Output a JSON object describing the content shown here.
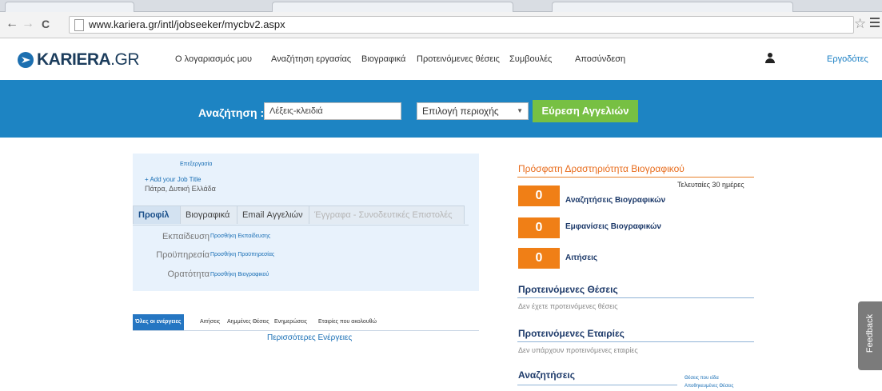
{
  "browser": {
    "url": "www.kariera.gr/intl/jobseeker/mycbv2.aspx",
    "back_icon": "←",
    "forward_icon": "→",
    "reload_icon": "C",
    "star_icon": "☆"
  },
  "header": {
    "logo_bold": "KARIERA",
    "logo_light": ".GR",
    "nav": [
      "Ο λογαριασμός μου",
      "Αναζήτηση εργασίας",
      "Βιογραφικά",
      "Προτεινόμενες θέσεις",
      "Συμβουλές",
      "Αποσύνδεση"
    ],
    "employers": "Εργοδότες"
  },
  "search": {
    "label": "Αναζήτηση :",
    "keywords_value": "Λέξεις-κλειδιά",
    "region_value": "Επιλογή περιοχής",
    "button": "Εύρεση Αγγελιών"
  },
  "profile": {
    "edit": "Επεξεργασία",
    "add_title": "+ Add your Job Title",
    "location": "Πάτρα, Δυτική Ελλάδα",
    "tabs": [
      "Προφίλ",
      "Βιογραφικά",
      "Email Αγγελιών",
      "Έγγραφα - Συνοδευτικές Επιστολές"
    ],
    "rows": [
      {
        "label": "Εκπαίδευση",
        "link": "Προσθήκη Εκπαίδευσης"
      },
      {
        "label": "Προϋπηρεσία",
        "link": "Προσθήκη Προϋπηρεσίας"
      },
      {
        "label": "Ορατότητα",
        "link": "Προσθήκη Βιογραφικού"
      }
    ]
  },
  "activity": {
    "tabs": [
      "Όλες οι ενέργειες",
      "Αιτήσεις",
      "Αημμένες Θέσεις",
      "Ενημερώσεις",
      "Εταιρίες που ακολουθώ"
    ],
    "more": "Περισσότερες Ενέργειες"
  },
  "right": {
    "recent_title": "Πρόσφατη Δραστηριότητα Βιογραφικού",
    "last_days": "Τελευταίες 30 ημέρες",
    "stats": [
      {
        "value": "0",
        "label": "Αναζητήσεις Βιογραφικών"
      },
      {
        "value": "0",
        "label": "Εμφανίσεις Βιογραφικών"
      },
      {
        "value": "0",
        "label": "Αιτήσεις"
      }
    ],
    "suggested_jobs_title": "Προτεινόμενες Θέσεις",
    "suggested_jobs_text": "Δεν έχετε προτεινόμενες θέσεις",
    "suggested_companies_title": "Προτεινόμενες Εταιρίες",
    "suggested_companies_text": "Δεν υπάρχουν προτεινόμενες εταιρίες",
    "searches_title": "Αναζητήσεις",
    "searches_links": [
      "Θέσεις που είδα",
      "Αποθηκευμένες Θέσεις"
    ]
  },
  "feedback": "Feedback",
  "colors": {
    "brand_blue": "#1d84c3",
    "find_green": "#77c043",
    "stat_orange": "#f07f16",
    "panel_bg": "#e8f2fc"
  }
}
